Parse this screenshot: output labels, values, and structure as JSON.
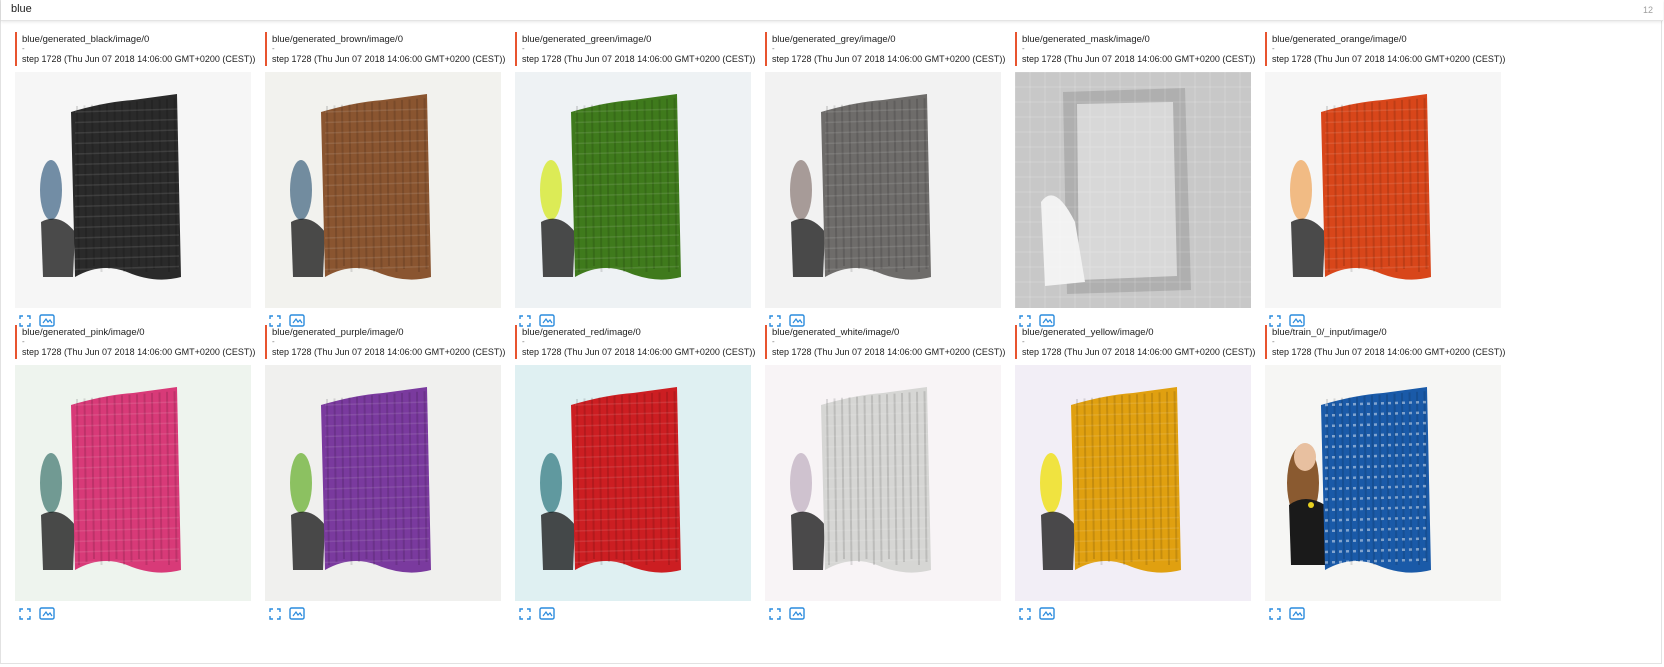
{
  "group": {
    "name": "blue",
    "count": "12"
  },
  "colors": {
    "accent": "#e8542f",
    "action_icon": "#2a8bdd"
  },
  "cards": [
    {
      "title": "blue/generated_black/image/0",
      "dash": "-",
      "step": "step 1728 (Thu Jun 07 2018 14:06:00 GMT+0200 (CEST))",
      "kind": "flag",
      "fill": "#2a2a2a",
      "bg": "#f6f6f6",
      "blob": "#5a7a96"
    },
    {
      "title": "blue/generated_brown/image/0",
      "dash": "-",
      "step": "step 1728 (Thu Jun 07 2018 14:06:00 GMT+0200 (CEST))",
      "kind": "flag",
      "fill": "#8a5530",
      "bg": "#f2f2ee",
      "blob": "#5c7a90"
    },
    {
      "title": "blue/generated_green/image/0",
      "dash": "-",
      "step": "step 1728 (Thu Jun 07 2018 14:06:00 GMT+0200 (CEST))",
      "kind": "flag",
      "fill": "#3f7a1c",
      "bg": "#eef2f4",
      "blob": "#d8ea3a"
    },
    {
      "title": "blue/generated_grey/image/0",
      "dash": "-",
      "step": "step 1728 (Thu Jun 07 2018 14:06:00 GMT+0200 (CEST))",
      "kind": "flag",
      "fill": "#6e6c6a",
      "bg": "#f2f2f2",
      "blob": "#9a8c88"
    },
    {
      "title": "blue/generated_mask/image/0",
      "dash": "-",
      "step": "step 1728 (Thu Jun 07 2018 14:06:00 GMT+0200 (CEST))",
      "kind": "mask",
      "fill": "#b8b8b8",
      "bg": "#c8c8c8",
      "blob": "#f2f2f2"
    },
    {
      "title": "blue/generated_orange/image/0",
      "dash": "-",
      "step": "step 1728 (Thu Jun 07 2018 14:06:00 GMT+0200 (CEST))",
      "kind": "flag",
      "fill": "#d8461a",
      "bg": "#f6f6f6",
      "blob": "#f0b070"
    },
    {
      "title": "blue/generated_pink/image/0",
      "dash": "-",
      "step": "step 1728 (Thu Jun 07 2018 14:06:00 GMT+0200 (CEST))",
      "kind": "flag",
      "fill": "#d83a78",
      "bg": "#eef4ee",
      "blob": "#5a8a82"
    },
    {
      "title": "blue/generated_purple/image/0",
      "dash": "-",
      "step": "step 1728 (Thu Jun 07 2018 14:06:00 GMT+0200 (CEST))",
      "kind": "flag",
      "fill": "#7a3a9e",
      "bg": "#f0f0ee",
      "blob": "#7ab848"
    },
    {
      "title": "blue/generated_red/image/0",
      "dash": "-",
      "step": "step 1728 (Thu Jun 07 2018 14:06:00 GMT+0200 (CEST))",
      "kind": "flag",
      "fill": "#cc1e22",
      "bg": "#dff0f2",
      "blob": "#4a8a90"
    },
    {
      "title": "blue/generated_white/image/0",
      "dash": "-",
      "step": "step 1728 (Thu Jun 07 2018 14:06:00 GMT+0200 (CEST))",
      "kind": "flag",
      "fill": "#d6d6d4",
      "bg": "#f8f4f6",
      "blob": "#c8b8c8"
    },
    {
      "title": "blue/generated_yellow/image/0",
      "dash": "-",
      "step": "step 1728 (Thu Jun 07 2018 14:06:00 GMT+0200 (CEST))",
      "kind": "flag",
      "fill": "#e0a010",
      "bg": "#f2eef6",
      "blob": "#f0e020"
    },
    {
      "title": "blue/train_0/_input/image/0",
      "dash": "-",
      "step": "step 1728 (Thu Jun 07 2018 14:06:00 GMT+0200 (CEST))",
      "kind": "photo",
      "fill": "#1a5aa8",
      "bg": "#f6f6f4",
      "blob": "#1a1a1a"
    }
  ]
}
